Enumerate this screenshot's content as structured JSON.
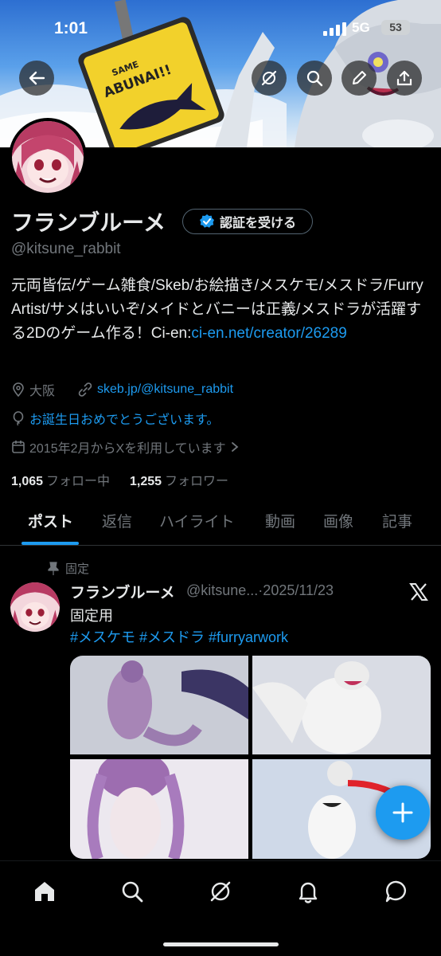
{
  "status_bar": {
    "time": "1:01",
    "network": "5G",
    "battery": "53"
  },
  "profile": {
    "display_name": "フランブルーメ",
    "verify_button_label": "認証を受ける",
    "handle": "@kitsune_rabbit",
    "bio_text": "元両皆伝/ゲーム雑食/Skeb/お絵描き/メスケモ/メスドラ/Furry Artist/サメはいいぞ/メイドとバニーは正義/メスドラが活躍する2Dのゲーム作る！Ci-en:",
    "bio_link": "ci-en.net/creator/26289",
    "location": "大阪",
    "website": "skeb.jp/@kitsune_rabbit",
    "birthday": "お誕生日おめでとうございます。",
    "joined": "2015年2月からXを利用しています",
    "following_count": "1,065",
    "following_label": "フォロー中",
    "followers_count": "1,255",
    "followers_label": "フォロワー"
  },
  "banner": {
    "sign_line1": "SAME",
    "sign_line2": "ABUNAI!!"
  },
  "tabs": [
    {
      "label": "ポスト",
      "active": true
    },
    {
      "label": "返信"
    },
    {
      "label": "ハイライト"
    },
    {
      "label": "動画"
    },
    {
      "label": "画像"
    },
    {
      "label": "記事"
    }
  ],
  "post": {
    "pinned_label": "固定",
    "author_name": "フランブルーメ",
    "author_handle_date": "@kitsune...·2025/11/23",
    "text": "固定用",
    "hashtags": "#メスケモ #メスドラ #furryarwork"
  },
  "colors": {
    "accent": "#1d9bf0",
    "background": "#000000",
    "muted": "#71767b"
  },
  "icons": {
    "header": [
      "back-arrow-icon",
      "grok-icon",
      "search-icon",
      "edit-icon",
      "share-icon"
    ],
    "bottom_nav": [
      "home-icon",
      "search-icon",
      "grok-icon",
      "notifications-icon",
      "messages-icon"
    ]
  }
}
